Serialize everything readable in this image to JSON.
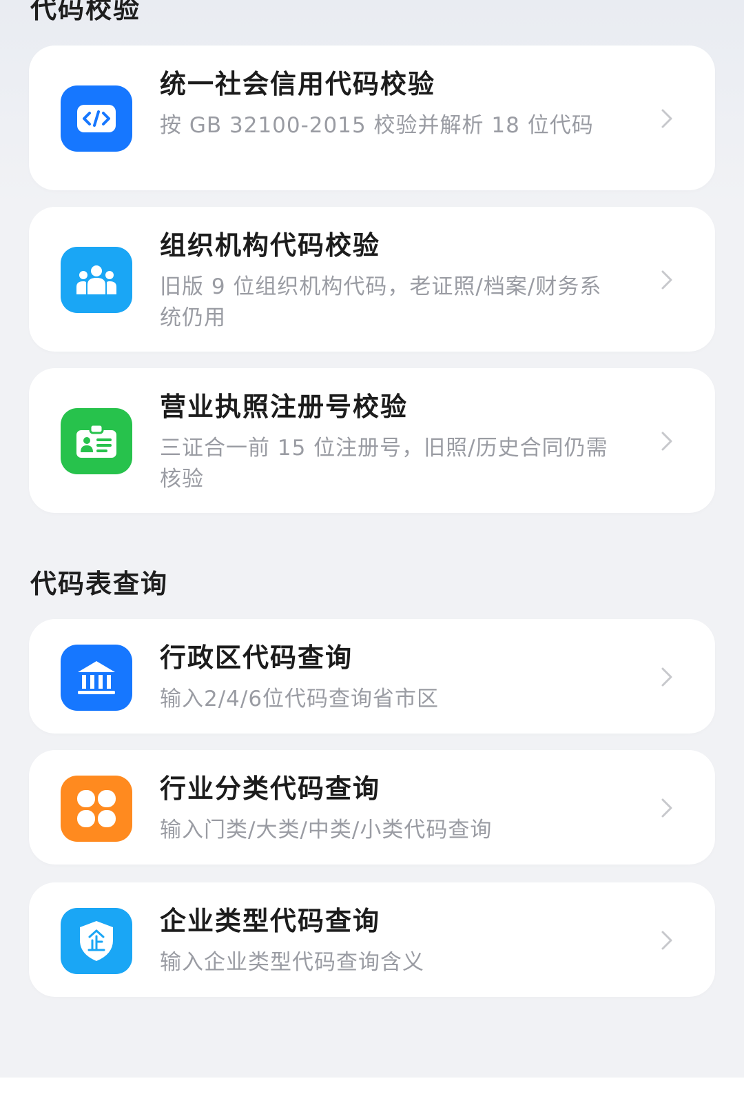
{
  "sections": [
    {
      "title": "代码校验",
      "items": [
        {
          "title": "统一社会信用代码校验",
          "desc": "按 GB 32100-2015 校验并解析 18 位代码",
          "icon": "code-icon",
          "color": "#1677ff"
        },
        {
          "title": "组织机构代码校验",
          "desc": "旧版 9 位组织机构代码，老证照/档案/财务系统仍用",
          "icon": "people-group-icon",
          "color": "#1aa6f5"
        },
        {
          "title": "营业执照注册号校验",
          "desc": "三证合一前 15 位注册号，旧照/历史合同仍需核验",
          "icon": "id-card-icon",
          "color": "#27c24c"
        }
      ]
    },
    {
      "title": "代码表查询",
      "items": [
        {
          "title": "行政区代码查询",
          "desc": "输入2/4/6位代码查询省市区",
          "icon": "government-building-icon",
          "color": "#1677ff"
        },
        {
          "title": "行业分类代码查询",
          "desc": "输入门类/大类/中类/小类代码查询",
          "icon": "four-petal-grid-icon",
          "color": "#ff8a1f"
        },
        {
          "title": "企业类型代码查询",
          "desc": "输入企业类型代码查询含义",
          "icon": "enterprise-shield-icon",
          "color": "#1aa6f5"
        }
      ]
    }
  ]
}
